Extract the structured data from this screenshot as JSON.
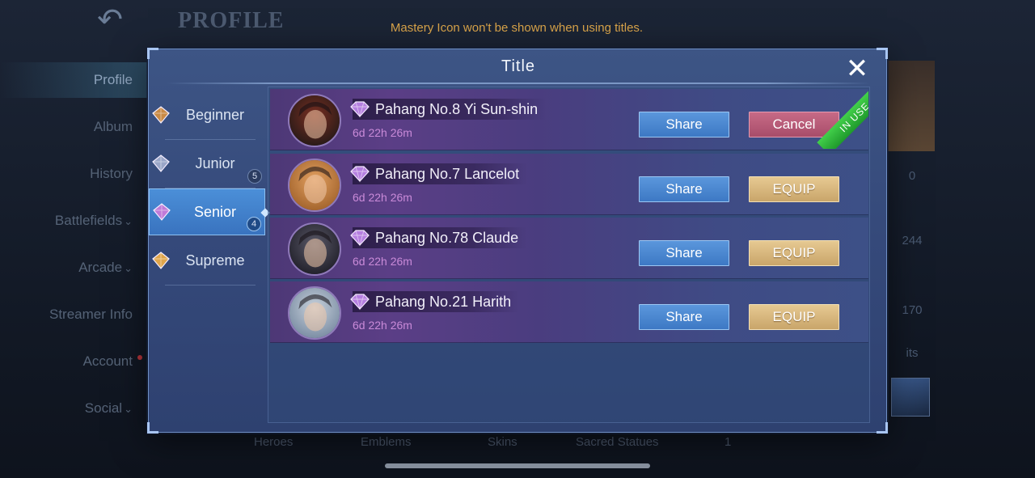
{
  "background": {
    "back_icon": "back-arrow-icon",
    "page_title": "PROFILE",
    "notice": "Mastery Icon won't be shown when using titles.",
    "sidebar": [
      {
        "label": "Profile",
        "active": true,
        "chevron": false,
        "dot": false
      },
      {
        "label": "Album",
        "active": false,
        "chevron": false,
        "dot": false
      },
      {
        "label": "History",
        "active": false,
        "chevron": false,
        "dot": false
      },
      {
        "label": "Battlefields",
        "active": false,
        "chevron": true,
        "dot": false
      },
      {
        "label": "Arcade",
        "active": false,
        "chevron": true,
        "dot": false
      },
      {
        "label": "Streamer Info",
        "active": false,
        "chevron": false,
        "dot": false
      },
      {
        "label": "Account",
        "active": false,
        "chevron": false,
        "dot": true
      },
      {
        "label": "Social",
        "active": false,
        "chevron": true,
        "dot": false
      }
    ],
    "right_stats": [
      "0",
      "244",
      "170",
      "its"
    ],
    "bottom_labels": [
      "Heroes",
      "Emblems",
      "Skins",
      "Sacred Statues",
      "1"
    ]
  },
  "modal": {
    "title": "Title",
    "close_icon": "close-icon",
    "tiers": [
      {
        "label": "Beginner",
        "badge": "",
        "active": false,
        "icon_color": "#c98a45"
      },
      {
        "label": "Junior",
        "badge": "5",
        "active": false,
        "icon_color": "#9aa6c8"
      },
      {
        "label": "Senior",
        "badge": "4",
        "active": true,
        "icon_color": "#c07ad8"
      },
      {
        "label": "Supreme",
        "badge": "",
        "active": false,
        "icon_color": "#e0a54a"
      }
    ],
    "titles": [
      {
        "name": "Pahang No.8 Yi Sun-shin",
        "timer": "6d 22h 26m",
        "share_label": "Share",
        "action_label": "Cancel",
        "action_type": "cancel",
        "in_use": true,
        "in_use_label": "IN USE",
        "avatar_colors": [
          "#7a2f22",
          "#2a1b18"
        ]
      },
      {
        "name": "Pahang No.7 Lancelot",
        "timer": "6d 22h 26m",
        "share_label": "Share",
        "action_label": "EQUIP",
        "action_type": "equip",
        "in_use": false,
        "in_use_label": "",
        "avatar_colors": [
          "#e2a061",
          "#a5662e"
        ]
      },
      {
        "name": "Pahang No.78 Claude",
        "timer": "6d 22h 26m",
        "share_label": "Share",
        "action_label": "EQUIP",
        "action_type": "equip",
        "in_use": false,
        "in_use_label": "",
        "avatar_colors": [
          "#5a5968",
          "#23222c"
        ]
      },
      {
        "name": "Pahang No.21 Harith",
        "timer": "6d 22h 26m",
        "share_label": "Share",
        "action_label": "EQUIP",
        "action_type": "equip",
        "in_use": false,
        "in_use_label": "",
        "avatar_colors": [
          "#c9d2dc",
          "#7d8fa5"
        ]
      }
    ]
  },
  "colors": {
    "modal_bg": "#3a5082",
    "share_button": "#4a86d0",
    "equip_button": "#d7b77e",
    "cancel_button": "#b85a78",
    "in_use_ribbon": "#2fb53b",
    "timer_text": "#c98ad8",
    "notice_text": "#d9a44a"
  }
}
